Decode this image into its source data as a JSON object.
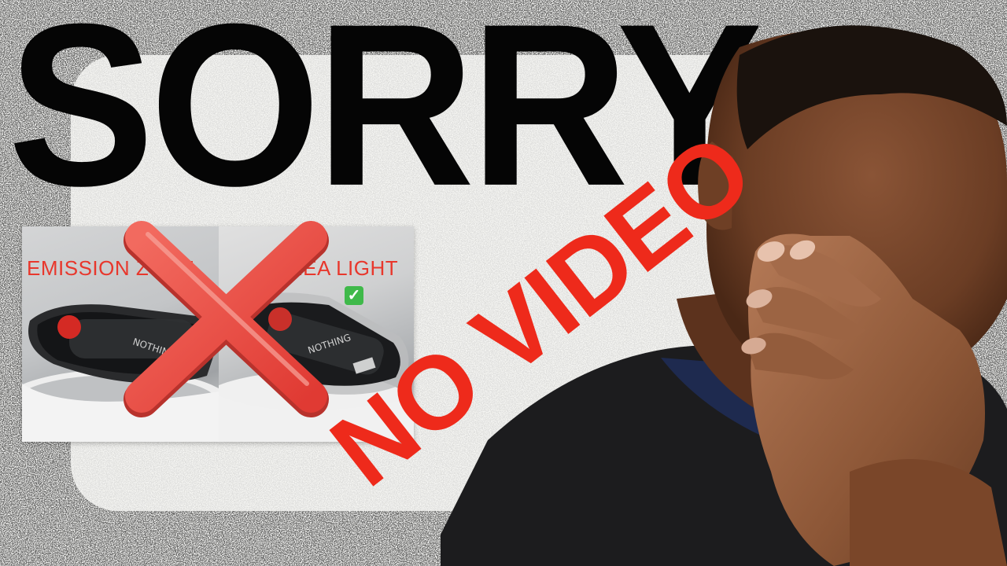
{
  "headline": "SORRY",
  "product_image": {
    "left_label": "EMISSION ZONE",
    "right_label": "AREA LIGHT",
    "brand_left": "NOTHING",
    "brand_right": "NOTHING",
    "check_icon": "check-mark-icon"
  },
  "overlay_text": "NO VIDEO",
  "colors": {
    "headline": "#050505",
    "overlay_red": "#ee2a1b",
    "cross_red": "#ef4b45",
    "label_red": "#e8372c",
    "check_green": "#3fb94a",
    "shirt": "#1c1c1e",
    "skin": "#7a4a30",
    "background": "#f4f4f2"
  }
}
